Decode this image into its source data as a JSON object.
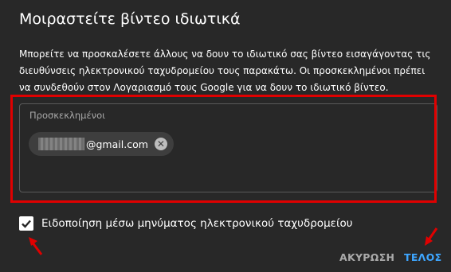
{
  "dialog": {
    "title": "Μοιραστείτε βίντεο ιδιωτικά",
    "description": "Μπορείτε να προσκαλέσετε άλλους να δουν το ιδιωτικό σας βίντεο εισαγάγοντας τις διευθύνσεις ηλεκτρονικού ταχυδρομείου τους παρακάτω. Οι προσκεκλημένοι πρέπει να συνδεθούν στον Λογαριασμό τους Google για να δουν το ιδιωτικό βίντεο.",
    "invitees": {
      "label": "Προσκεκλημένοι",
      "chips": [
        {
          "email_visible": "@gmail.com"
        }
      ]
    },
    "notify_email": {
      "checked": true,
      "label": "Ειδοποίηση μέσω μηνύματος ηλεκτρονικού ταχυδρομείου"
    },
    "actions": {
      "cancel_label": "ΑΚΥΡΩΣΗ",
      "done_label": "ΤΕΛΟΣ"
    }
  },
  "colors": {
    "background": "#282828",
    "accent": "#3ea6ff",
    "annotation_red": "#e00000"
  },
  "icons": {
    "chip_remove": "close-circle-icon",
    "checkbox": "check-icon",
    "annotation": "red-arrow-icon"
  }
}
